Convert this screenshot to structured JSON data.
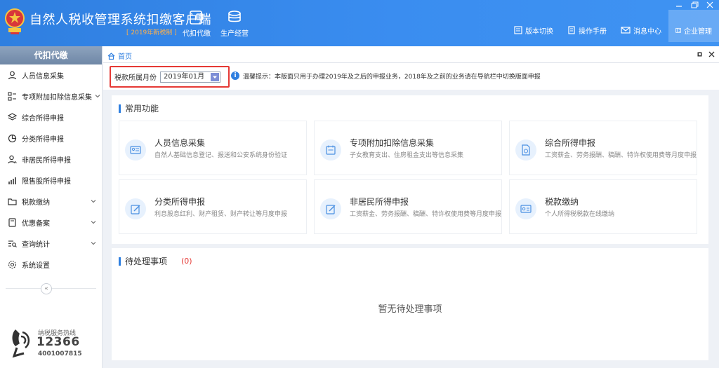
{
  "app": {
    "title": "自然人税收管理系统扣缴客户端",
    "subtitle": "[ 2019年新税制 ]"
  },
  "topnav": [
    {
      "label": "代扣代缴",
      "icon": "withholding-icon"
    },
    {
      "label": "生产经营",
      "icon": "business-coins-icon"
    }
  ],
  "header_buttons": [
    {
      "label": "版本切换",
      "icon": "version-switch-icon"
    },
    {
      "label": "操作手册",
      "icon": "manual-icon"
    },
    {
      "label": "消息中心",
      "icon": "mail-icon"
    },
    {
      "label": "企业管理",
      "icon": "enterprise-icon"
    }
  ],
  "sidebar": {
    "heading": "代扣代缴",
    "items": [
      {
        "label": "人员信息采集",
        "icon": "person-icon",
        "has_children": false
      },
      {
        "label": "专项附加扣除信息采集",
        "icon": "grid-list-icon",
        "has_children": true
      },
      {
        "label": "综合所得申报",
        "icon": "layers-icon",
        "has_children": false
      },
      {
        "label": "分类所得申报",
        "icon": "pie-icon",
        "has_children": false
      },
      {
        "label": "非居民所得申报",
        "icon": "person-outline-icon",
        "has_children": false
      },
      {
        "label": "限售股所得申报",
        "icon": "bar-chart-icon",
        "has_children": false
      },
      {
        "label": "税款缴纳",
        "icon": "folder-icon",
        "has_children": true
      },
      {
        "label": "优惠备案",
        "icon": "document-icon",
        "has_children": true
      },
      {
        "label": "查询统计",
        "icon": "search-list-icon",
        "has_children": true
      },
      {
        "label": "系统设置",
        "icon": "gear-icon",
        "has_children": false
      }
    ],
    "collapse_glyph": "«",
    "hotline": {
      "label": "纳税服务热线",
      "number": "12366",
      "phone": "4001007815"
    }
  },
  "tabs": {
    "home_label": "首页"
  },
  "toolbar": {
    "month_label": "税款所属月份",
    "month_value": "2019年01月",
    "tip": "温馨提示：本版面只用于办理2019年及之后的申报业务，2018年及之前的业务请在导航栏中切换版面申报"
  },
  "common": {
    "title": "常用功能",
    "functions": [
      {
        "title": "人员信息采集",
        "desc": "自然人基础信息登记、报送和公安系统身份验证",
        "icon": "id-card-icon"
      },
      {
        "title": "专项附加扣除信息采集",
        "desc": "子女教育支出、住房租金支出等信息采集",
        "icon": "calendar-form-icon"
      },
      {
        "title": "综合所得申报",
        "desc": "工资薪金、劳务报酬、稿酬、特许权使用费等月度申报",
        "icon": "file-money-icon"
      },
      {
        "title": "分类所得申报",
        "desc": "利息股息红利、财产租赁、财产转让等月度申报",
        "icon": "edit-icon"
      },
      {
        "title": "非居民所得申报",
        "desc": "工资薪金、劳务报酬、稿酬、特许权使用费等月度申报",
        "icon": "edit-icon"
      },
      {
        "title": "税款缴纳",
        "desc": "个人所得税税款在线缴纳",
        "icon": "payment-card-icon"
      }
    ]
  },
  "pending": {
    "title": "待处理事项",
    "count": "(0)",
    "empty_text": "暂无待处理事项"
  },
  "colors": {
    "header_blue": "#2f7fe0",
    "accent_red": "#e53935",
    "subtitle_orange": "#ffb04a"
  }
}
